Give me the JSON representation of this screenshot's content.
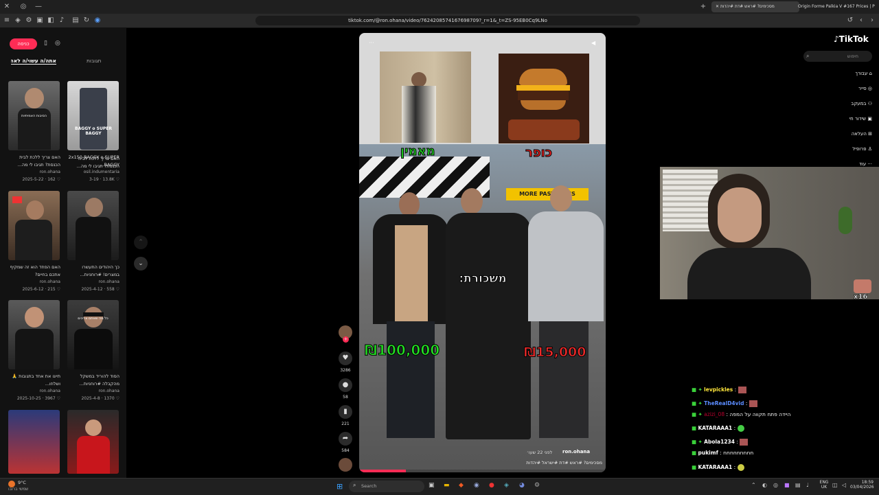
{
  "browser": {
    "tabs": [
      "מסכימים? #ראש #דת #יהדות",
      "Origin Forme Palkia V #167 Prices | P"
    ],
    "url": "tiktok.com/@ron.ohana/video/7624208574167698709?_r=1&_t=ZS-95EB0Cq9LNo"
  },
  "feed": {
    "login_button": "כניסה",
    "tabs": [
      "תגובות",
      "אתה/ה עשוי/ה לאהוב"
    ],
    "items": [
      {
        "caption": "האם צריך ללכת לבית הכנסת? תגיבו לי מה...",
        "author": "ron.ohana",
        "date": "2025-5-22",
        "likes": "162"
      },
      {
        "caption": "2x150 BAGGY o SUPER BAGGY...",
        "author": "osil.indumentaria",
        "date": "3-19",
        "likes": "13.8K"
      },
      {
        "caption": "האם הפחד הוא זה שמקיף אתכם בחיים?",
        "author": "ron.ohana",
        "date": "2025-6-12",
        "likes": "215"
      },
      {
        "caption": "כך היהודים התעשרו במצרים! #רוחניות...",
        "author": "ron.ohana",
        "date": "2025-4-12",
        "likes": "558"
      },
      {
        "caption": "תייגו את אחד בתגובות 🙏 ושלחו...",
        "author": "ron.ohana",
        "date": "2025-10-25",
        "likes": "3967"
      },
      {
        "caption": "הסוד להוריד במשקל מהקבלה #רוחניות...",
        "author": "ron.ohana",
        "date": "2025-4-8",
        "likes": "1370"
      }
    ],
    "thumb_texts": [
      "הסיבות האמיתיות",
      "BAGGY o SUPER BAGGY",
      "",
      "",
      "",
      "כל מה שאתם צריכים"
    ]
  },
  "video": {
    "label_left": "כופר",
    "label_right": "מאמין",
    "salary_label": "משכורת:",
    "price_left": "₪100,000",
    "price_right": "₪15,000",
    "shop_sign": "MORE PASTA LESS",
    "author": "ron.ohana",
    "time_ago": "לפני 22 שעו׳",
    "caption": "מסכימים? #ראש #דת #ישראל #יהדות"
  },
  "actions": {
    "likes": "3286",
    "comments": "58",
    "saves": "221",
    "shares": "584"
  },
  "tiktok": {
    "logo": "TikTok",
    "search_placeholder": "חיפוש",
    "nav": [
      "עבורך",
      "סייר",
      "במעקב",
      "שידור חי",
      "העלאה",
      "פרופיל",
      "עוד"
    ]
  },
  "webcam": {
    "badge": "x16"
  },
  "chat": [
    {
      "user": "levpickles",
      "text": "",
      "color": "#ffe53b"
    },
    {
      "user": "TheRealD4vid",
      "text": "",
      "color": "#5b8cff"
    },
    {
      "user": "azizi_08",
      "text": "היידה פתח תקווה על המפה",
      "color": "#b8002e"
    },
    {
      "user": "KATARAAA1",
      "text": "",
      "color": "#ffffff"
    },
    {
      "user": "Abola1234",
      "text": "",
      "color": "#ffffff"
    },
    {
      "user": "pukimf",
      "text": "חחחחחחחחח",
      "color": "#ffffff"
    },
    {
      "user": "KATARAAA1",
      "text": "",
      "color": "#ffffff"
    }
  ],
  "taskbar": {
    "weather_temp": "9°C",
    "weather_text": "שמשי ברובו",
    "search": "Search",
    "lang_top": "ENG",
    "lang_bottom": "UK",
    "time": "18:59",
    "date": "03/04/2026"
  }
}
